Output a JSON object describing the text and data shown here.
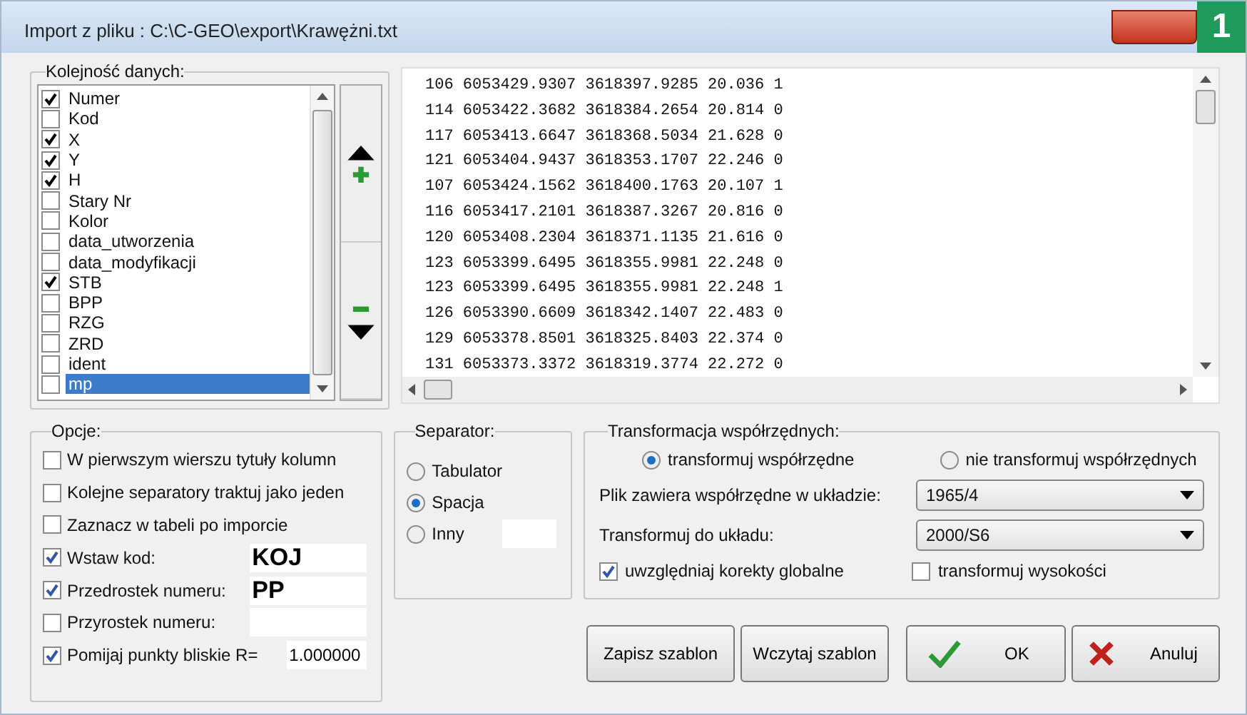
{
  "window": {
    "title": "Import z pliku : C:\\C-GEO\\export\\Krawężni.txt"
  },
  "badge": "1",
  "field_order": {
    "legend": "Kolejność danych:",
    "items": [
      {
        "label": "Numer",
        "checked": true,
        "selected": false
      },
      {
        "label": "Kod",
        "checked": false,
        "selected": false
      },
      {
        "label": "X",
        "checked": true,
        "selected": false
      },
      {
        "label": "Y",
        "checked": true,
        "selected": false
      },
      {
        "label": "H",
        "checked": true,
        "selected": false
      },
      {
        "label": "Stary Nr",
        "checked": false,
        "selected": false
      },
      {
        "label": "Kolor",
        "checked": false,
        "selected": false
      },
      {
        "label": "data_utworzenia",
        "checked": false,
        "selected": false
      },
      {
        "label": "data_modyfikacji",
        "checked": false,
        "selected": false
      },
      {
        "label": "STB",
        "checked": true,
        "selected": false
      },
      {
        "label": "BPP",
        "checked": false,
        "selected": false
      },
      {
        "label": "RZG",
        "checked": false,
        "selected": false
      },
      {
        "label": "ZRD",
        "checked": false,
        "selected": false
      },
      {
        "label": "ident",
        "checked": false,
        "selected": false
      },
      {
        "label": "mp",
        "checked": false,
        "selected": true
      }
    ]
  },
  "preview": {
    "lines": [
      "106 6053429.9307 3618397.9285 20.036 1",
      "114 6053422.3682 3618384.2654 20.814 0",
      "117 6053413.6647 3618368.5034 21.628 0",
      "121 6053404.9437 3618353.1707 22.246 0",
      "107 6053424.1562 3618400.1763 20.107 1",
      "116 6053417.2101 3618387.3267 20.816 0",
      "120 6053408.2304 3618371.1135 21.616 0",
      "123 6053399.6495 3618355.9981 22.248 0",
      "123 6053399.6495 3618355.9981 22.248 1",
      "126 6053390.6609 3618342.1407 22.483 0",
      "129 6053378.8501 3618325.8403 22.374 0",
      "131 6053373.3372 3618319.3774 22.272 0"
    ]
  },
  "options": {
    "legend": "Opcje:",
    "items": [
      {
        "kind": "check",
        "label": "W pierwszym wierszu tytuły kolumn",
        "checked": false
      },
      {
        "kind": "check",
        "label": "Kolejne separatory traktuj jako jeden",
        "checked": false
      },
      {
        "kind": "check",
        "label": "Zaznacz w tabeli po imporcie",
        "checked": false
      },
      {
        "kind": "field",
        "label": "Wstaw kod:",
        "checked": true,
        "value": "KOJ"
      },
      {
        "kind": "field",
        "label": "Przedrostek numeru:",
        "checked": true,
        "value": "PP"
      },
      {
        "kind": "field",
        "label": "Przyrostek numeru:",
        "checked": false
      },
      {
        "kind": "number",
        "label": "Pomijaj punkty bliskie R=",
        "checked": true,
        "value": "1.000000"
      }
    ]
  },
  "separator": {
    "legend": "Separator:",
    "options": [
      {
        "label": "Tabulator",
        "selected": false,
        "kind": "plain"
      },
      {
        "label": "Spacja",
        "selected": true,
        "kind": "plain"
      },
      {
        "label": "Inny",
        "selected": false,
        "kind": "other"
      }
    ]
  },
  "transformation": {
    "legend": "Transformacja współrzędnych:",
    "modes": [
      {
        "label": "transformuj współrzędne",
        "selected": true
      },
      {
        "label": "nie transformuj współrzędnych",
        "selected": false
      }
    ],
    "source": {
      "label": "Plik zawiera współrzędne w układzie:",
      "value": "1965/4"
    },
    "target": {
      "label": "Transformuj do układu:",
      "value": "2000/S6"
    },
    "checks": [
      {
        "label": "uwzględniaj korekty globalne",
        "checked": true
      },
      {
        "label": "transformuj wysokości",
        "checked": false
      }
    ]
  },
  "buttons": [
    {
      "kind": "plain",
      "label": "Zapisz szablon"
    },
    {
      "kind": "plain",
      "label": "Wczytaj szablon"
    },
    {
      "kind": "ok",
      "label": "OK"
    },
    {
      "kind": "cancel",
      "label": "Anuluj"
    }
  ]
}
